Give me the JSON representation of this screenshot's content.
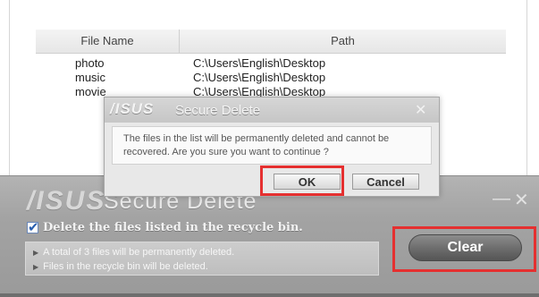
{
  "file_list": {
    "columns": [
      "File Name",
      "Path"
    ],
    "rows": [
      {
        "name": "photo",
        "path": "C:\\Users\\English\\Desktop"
      },
      {
        "name": "music",
        "path": "C:\\Users\\English\\Desktop"
      },
      {
        "name": "movie",
        "path": "C:\\Users\\English\\Desktop"
      }
    ]
  },
  "main_window": {
    "logo": "/ISUS",
    "title": "Secure Delete",
    "minimize_icon": "—",
    "close_icon": "✕",
    "checkbox_label": "Delete the files listed in the recycle bin.",
    "checkbox_checked": true,
    "info_lines": [
      "A total of 3 files will be permanently deleted.",
      "Files in the recycle bin will be deleted."
    ],
    "clear_label": "Clear"
  },
  "dialog": {
    "logo": "/ISUS",
    "title": "Secure Delete",
    "close_icon": "✕",
    "message": "The files in the list will be permanently deleted and cannot be recovered. Are you sure you want to continue ?",
    "ok_label": "OK",
    "cancel_label": "Cancel"
  },
  "colors": {
    "highlight": "#e53030",
    "window_gray": "#a3a3a3"
  }
}
